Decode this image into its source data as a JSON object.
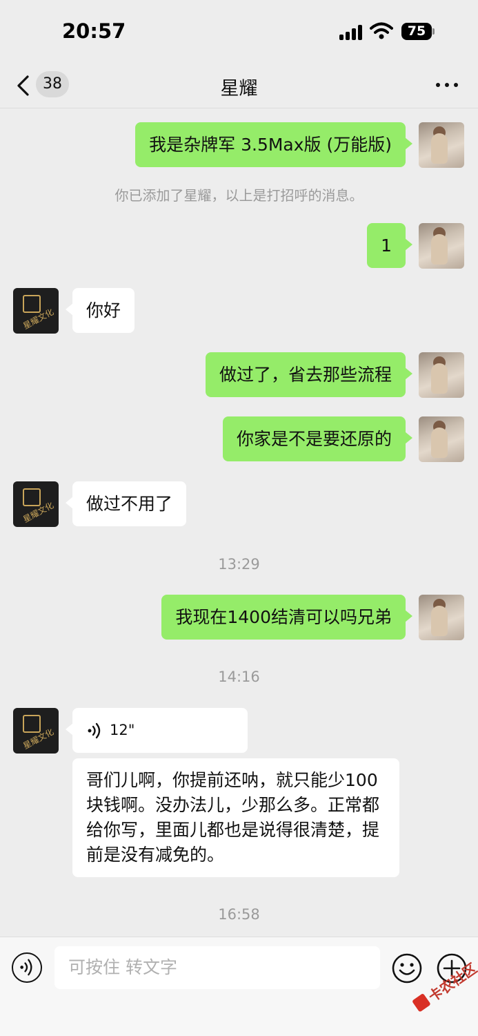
{
  "status_bar": {
    "time": "20:57",
    "battery": "75"
  },
  "nav": {
    "unread_count": "38",
    "title": "星耀"
  },
  "messages": {
    "m1": "我是杂牌军 3.5Max版 (万能版)",
    "system_notice": "你已添加了星耀，以上是打招呼的消息。",
    "m2": "1",
    "m3": "你好",
    "m4": "做过了，省去那些流程",
    "m5": "你家是不是要还原的",
    "m6": "做过不用了",
    "time1": "13:29",
    "m7": "我现在1400结清可以吗兄弟",
    "time2": "14:16",
    "voice_duration": "12\"",
    "m8": "哥们儿啊，你提前还呐，就只能少100块钱啊。没办法儿，少那么多。正常都给你写，里面儿都也是说得很清楚，提前是没有减免的。",
    "time3": "16:58"
  },
  "input": {
    "placeholder": "可按住 转文字"
  },
  "watermark": {
    "text": "卡农社区"
  },
  "colors": {
    "my_bubble": "#95ec69",
    "their_bubble": "#ffffff",
    "background": "#ededed"
  },
  "icons": [
    "signal-icon",
    "wifi-icon",
    "battery-icon",
    "back-icon",
    "more-icon",
    "voice-wave-icon",
    "voice-input-icon",
    "emoji-icon",
    "plus-icon"
  ]
}
